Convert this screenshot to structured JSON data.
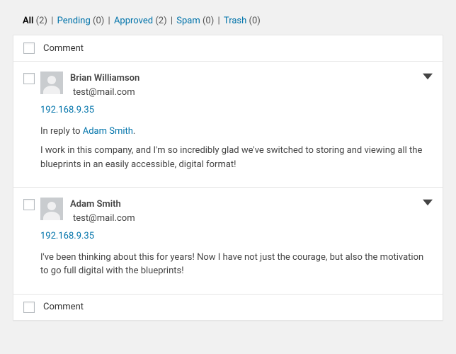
{
  "filters": {
    "all": {
      "label": "All",
      "count": "(2)"
    },
    "pending": {
      "label": "Pending",
      "count": "(0)"
    },
    "approved": {
      "label": "Approved",
      "count": "(2)"
    },
    "spam": {
      "label": "Spam",
      "count": "(0)"
    },
    "trash": {
      "label": "Trash",
      "count": "(0)"
    },
    "separator": " | "
  },
  "columns": {
    "comment": "Comment"
  },
  "comments": [
    {
      "author": "Brian Williamson",
      "email": "test@mail.com",
      "ip": "192.168.9.35",
      "reply_prefix": "In reply to ",
      "reply_to": "Adam Smith",
      "reply_suffix": ".",
      "text": "I work in this company, and I'm so incredibly glad we've switched to storing and viewing all the blueprints in an easily accessible, digital format!"
    },
    {
      "author": "Adam Smith",
      "email": "test@mail.com",
      "ip": "192.168.9.35",
      "text": "I've been thinking about this for years! Now I have not just the courage, but also the motivation to go full digital with the blueprints!"
    }
  ]
}
